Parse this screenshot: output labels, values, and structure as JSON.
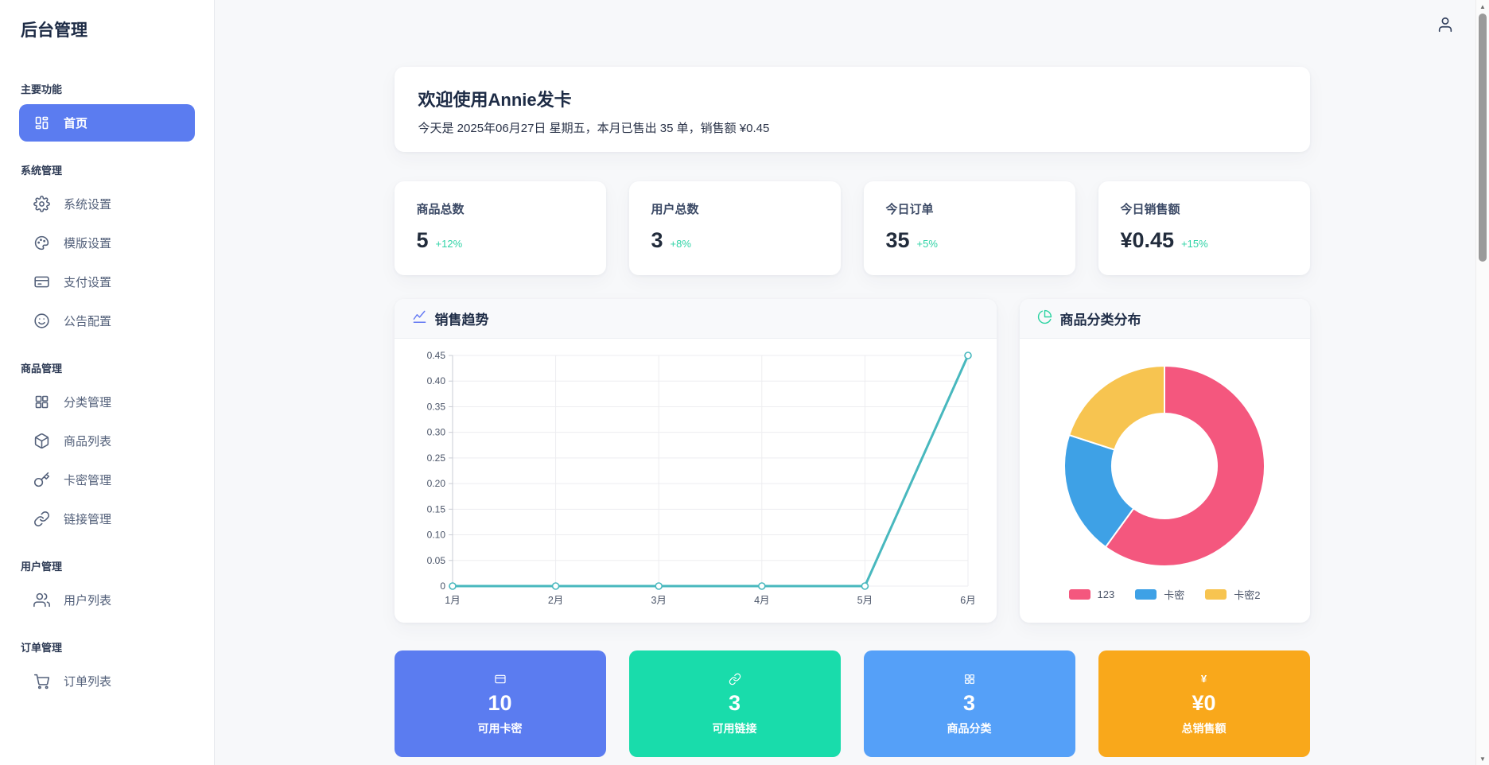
{
  "app": {
    "title": "后台管理"
  },
  "topbar": {
    "user_icon": "user-icon"
  },
  "sidebar": {
    "sections": [
      {
        "label": "主要功能",
        "items": [
          {
            "label": "首页",
            "icon": "dashboard-icon",
            "active": true
          }
        ]
      },
      {
        "label": "系统管理",
        "items": [
          {
            "label": "系统设置",
            "icon": "gear-icon",
            "active": false
          },
          {
            "label": "模版设置",
            "icon": "palette-icon",
            "active": false
          },
          {
            "label": "支付设置",
            "icon": "credit-card-icon",
            "active": false
          },
          {
            "label": "公告配置",
            "icon": "smile-icon",
            "active": false
          }
        ]
      },
      {
        "label": "商品管理",
        "items": [
          {
            "label": "分类管理",
            "icon": "grid-icon",
            "active": false
          },
          {
            "label": "商品列表",
            "icon": "package-icon",
            "active": false
          },
          {
            "label": "卡密管理",
            "icon": "key-icon",
            "active": false
          },
          {
            "label": "链接管理",
            "icon": "link-icon",
            "active": false
          }
        ]
      },
      {
        "label": "用户管理",
        "items": [
          {
            "label": "用户列表",
            "icon": "users-icon",
            "active": false
          }
        ]
      },
      {
        "label": "订单管理",
        "items": [
          {
            "label": "订单列表",
            "icon": "cart-icon",
            "active": false
          }
        ]
      }
    ],
    "active_color": "#5b7cf0"
  },
  "welcome": {
    "title": "欢迎使用Annie发卡",
    "subtitle": "今天是 2025年06月27日 星期五，本月已售出 35 单，销售额 ¥0.45"
  },
  "stats": [
    {
      "label": "商品总数",
      "value": "5",
      "delta": "+12%"
    },
    {
      "label": "用户总数",
      "value": "3",
      "delta": "+8%"
    },
    {
      "label": "今日订单",
      "value": "35",
      "delta": "+5%"
    },
    {
      "label": "今日销售额",
      "value": "¥0.45",
      "delta": "+15%"
    }
  ],
  "chart_data": [
    {
      "type": "line",
      "title": "销售趋势",
      "x": [
        "1月",
        "2月",
        "3月",
        "4月",
        "5月",
        "6月"
      ],
      "values": [
        0,
        0,
        0,
        0,
        0,
        0.45
      ],
      "ylim": [
        0,
        0.45
      ],
      "yticks": [
        0,
        0.05,
        0.1,
        0.15,
        0.2,
        0.25,
        0.3,
        0.35,
        0.4,
        0.45
      ],
      "grid": true,
      "line_color": "#48b8be",
      "legend_position": "none"
    },
    {
      "type": "pie",
      "title": "商品分类分布",
      "labels": [
        "123",
        "卡密",
        "卡密2"
      ],
      "values": [
        60,
        20,
        20
      ],
      "colors": [
        "#f4577e",
        "#3ea1e6",
        "#f7c450"
      ],
      "donut": true,
      "legend_position": "bottom"
    }
  ],
  "quick_cards": [
    {
      "value": "10",
      "label": "可用卡密",
      "color": "#5b7cf0",
      "icon": "card-icon"
    },
    {
      "value": "3",
      "label": "可用链接",
      "color": "#19dcab",
      "icon": "link-icon"
    },
    {
      "value": "3",
      "label": "商品分类",
      "color": "#55a0f8",
      "icon": "grid-icon"
    },
    {
      "value": "¥0",
      "label": "总销售额",
      "color": "#f9a81b",
      "icon": "yen-icon"
    }
  ]
}
